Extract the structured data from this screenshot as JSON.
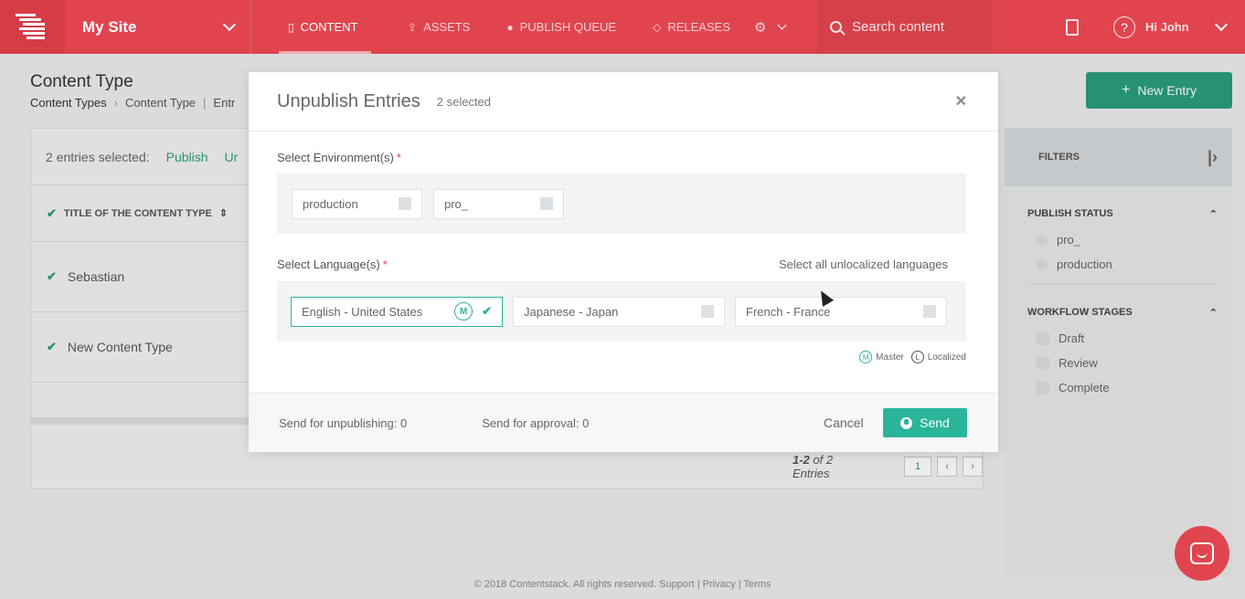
{
  "topbar": {
    "site_name": "My Site",
    "nav": [
      {
        "label": "CONTENT",
        "icon": "document-icon"
      },
      {
        "label": "ASSETS",
        "icon": "upload-icon"
      },
      {
        "label": "PUBLISH QUEUE",
        "icon": "globe-icon"
      },
      {
        "label": "RELEASES",
        "icon": "releases-icon"
      }
    ],
    "search_placeholder": "Search content",
    "greeting": "Hi  John"
  },
  "page": {
    "title": "Content Type",
    "breadcrumbs": [
      "Content Types",
      "Content Type",
      "Entr"
    ],
    "new_entry_label": "New Entry",
    "selection_text": "2 entries selected:",
    "selection_actions": [
      "Publish",
      "Ur"
    ],
    "column_header": "TITLE OF THE CONTENT TYPE",
    "rows": [
      "Sebastian",
      "New Content Type"
    ],
    "pager_range": "1-2",
    "pager_suffix": " of 2 Entries",
    "pager_page": "1"
  },
  "filters": {
    "title": "FILTERS",
    "publish_status_title": "PUBLISH STATUS",
    "publish_status": [
      "pro_",
      "production"
    ],
    "workflow_title": "WORKFLOW STAGES",
    "workflow": [
      "Draft",
      "Review",
      "Complete"
    ]
  },
  "footer": "© 2018 Contentstack. All rights reserved. Support | Privacy | Terms",
  "modal": {
    "title": "Unpublish Entries",
    "selected_count": "2 selected",
    "env_label": "Select Environment(s)",
    "environments": [
      "production",
      "pro_"
    ],
    "lang_label": "Select Language(s)",
    "select_all_link": "Select all unlocalized languages",
    "languages": [
      {
        "label": "English - United States",
        "selected": true,
        "badge": "M"
      },
      {
        "label": "Japanese - Japan",
        "selected": false
      },
      {
        "label": "French - France",
        "selected": false
      }
    ],
    "legend_master": "Master",
    "legend_localized": "Localized",
    "send_unpublishing": "Send for unpublishing: 0",
    "send_approval": "Send for approval: 0",
    "cancel_label": "Cancel",
    "send_label": "Send"
  },
  "colors": {
    "brand": "#e0454f",
    "accent": "#2ab59a",
    "action": "#2a9d7d"
  }
}
